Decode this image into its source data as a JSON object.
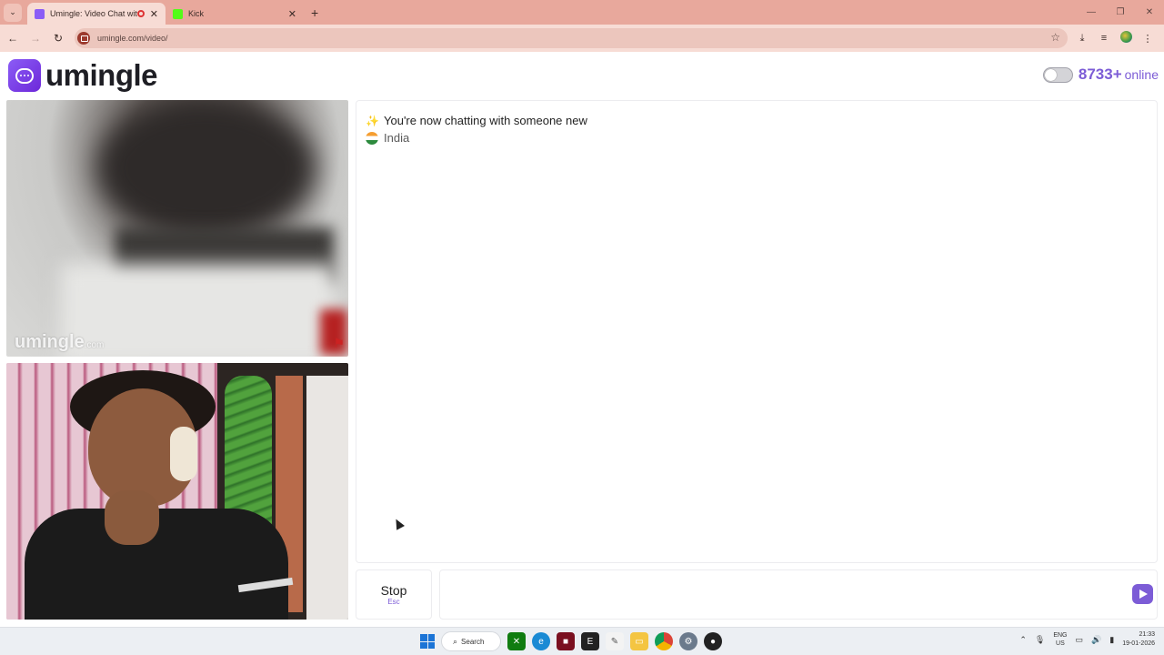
{
  "browser": {
    "tabs": [
      {
        "title": "Umingle: Video Chat with St",
        "active": true,
        "favicon_color": "#8b5cf6",
        "recording": true
      },
      {
        "title": "Kick",
        "active": false,
        "favicon_color": "#53fc18"
      }
    ],
    "new_tab_icon": "plus-icon",
    "url": "umingle.com/video/",
    "window_controls": [
      "minimize",
      "maximize",
      "close"
    ]
  },
  "site": {
    "logo_text": "umingle",
    "online_count": "8733+",
    "online_label": "online",
    "toggle_on": false,
    "accent_color": "#7c5cd6"
  },
  "remote_video": {
    "watermark": "umingle",
    "watermark_suffix": ".com"
  },
  "chat": {
    "messages": [
      {
        "icon": "sparkles-icon",
        "text": "You're now chatting with someone new"
      },
      {
        "icon": "india-flag-icon",
        "text": "India"
      }
    ],
    "stop_label": "Stop",
    "stop_shortcut": "Esc",
    "input_value": "",
    "send_icon": "send-icon"
  },
  "taskbar": {
    "search_label": "Search",
    "language": "ENG",
    "region": "US",
    "time": "21:33",
    "date": "19-01-2026"
  }
}
